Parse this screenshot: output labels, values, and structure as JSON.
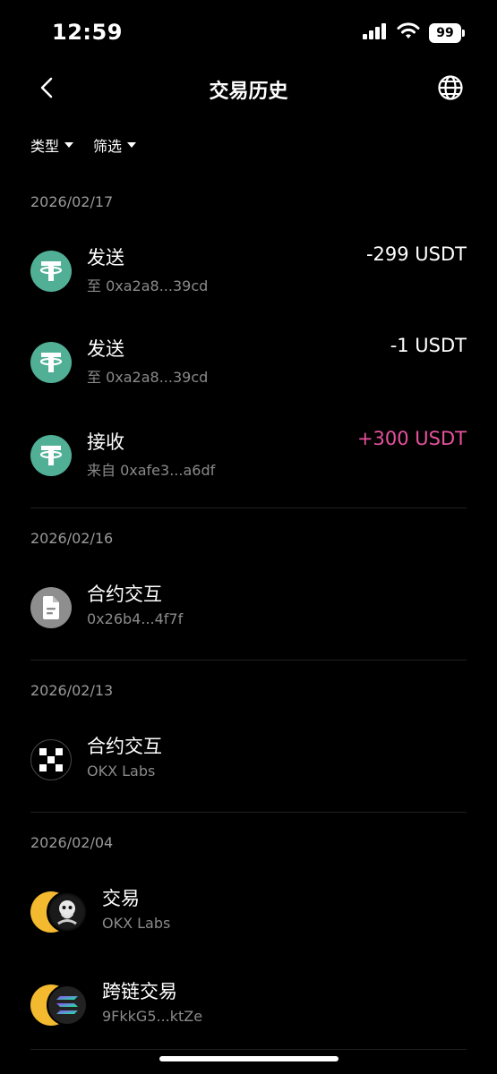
{
  "status": {
    "time": "12:59",
    "battery": "99"
  },
  "nav": {
    "title": "交易历史"
  },
  "filters": {
    "type_label": "类型",
    "filter_label": "筛选"
  },
  "groups": [
    {
      "date": "2026/02/17",
      "items": [
        {
          "title": "发送",
          "subtitle": "至 0xa2a8...39cd",
          "amount": "-299 USDT",
          "icon": "usdt-icon"
        },
        {
          "title": "发送",
          "subtitle": "至 0xa2a8...39cd",
          "amount": "-1 USDT",
          "icon": "usdt-icon"
        },
        {
          "title": "接收",
          "subtitle": "来自 0xafe3...a6df",
          "amount": "+300 USDT",
          "icon": "usdt-icon",
          "amount_color": "#e8519d"
        }
      ]
    },
    {
      "date": "2026/02/16",
      "items": [
        {
          "title": "合约交互",
          "subtitle": "0x26b4...4f7f",
          "icon": "contract-document-icon"
        }
      ]
    },
    {
      "date": "2026/02/13",
      "items": [
        {
          "title": "合约交互",
          "subtitle": "OKX Labs",
          "icon": "okx-logo-icon"
        }
      ]
    },
    {
      "date": "2026/02/04",
      "items": [
        {
          "title": "交易",
          "subtitle": "OKX Labs",
          "icon": "bnb-and-token-pair-icon"
        },
        {
          "title": "跨链交易",
          "subtitle": "9FkkG5...ktZe",
          "icon": "bnb-and-solana-pair-icon"
        }
      ]
    }
  ],
  "colors": {
    "usdt": "#50AF95",
    "positive": "#e8519d",
    "bnb": "#F3BA2F"
  }
}
